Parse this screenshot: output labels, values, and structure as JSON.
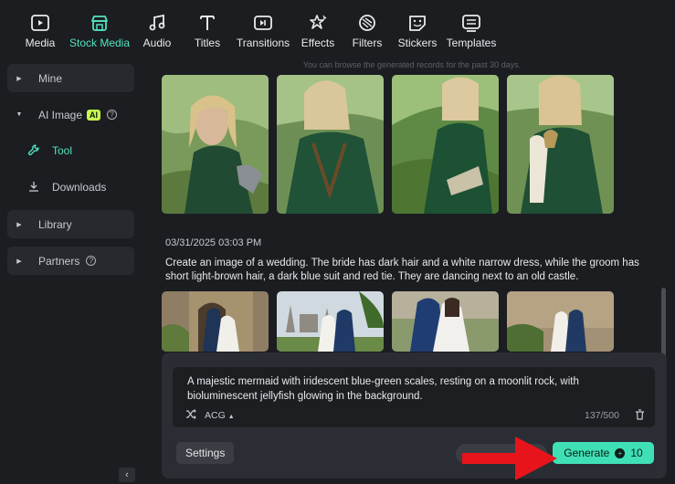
{
  "toolbar": {
    "tabs": [
      {
        "label": "Media",
        "icon": "media-icon"
      },
      {
        "label": "Stock Media",
        "icon": "stock-media-icon",
        "active": true
      },
      {
        "label": "Audio",
        "icon": "audio-note-icon"
      },
      {
        "label": "Titles",
        "icon": "titles-t-icon"
      },
      {
        "label": "Transitions",
        "icon": "transitions-icon"
      },
      {
        "label": "Effects",
        "icon": "effects-icon"
      },
      {
        "label": "Filters",
        "icon": "filters-icon"
      },
      {
        "label": "Stickers",
        "icon": "stickers-icon"
      },
      {
        "label": "Templates",
        "icon": "templates-icon"
      }
    ]
  },
  "sidebar": {
    "mine": "Mine",
    "ai_image": "AI Image",
    "ai_badge": "AI",
    "tool": "Tool",
    "downloads": "Downloads",
    "library": "Library",
    "partners": "Partners"
  },
  "main": {
    "notice": "You can browse the generated records for the past 30 days.",
    "record": {
      "timestamp": "03/31/2025 03:03 PM",
      "prompt": "Create an image of a wedding. The bride has dark hair and a white narrow dress, while the groom has short light-brown hair, a dark blue suit and red tie. They are dancing next to an old castle."
    }
  },
  "composer": {
    "text": "A majestic mermaid with iridescent blue-green scales, resting on a moonlit rock, with bioluminescent jellyfish glowing in the background.",
    "style": "ACG",
    "count": "137/500",
    "settings_label": "Settings",
    "generate_label": "Generate",
    "generate_cost": "10"
  },
  "colors": {
    "accent": "#3fe0b5",
    "active_text": "#52e3bf",
    "ai_badge": "#c7f94e",
    "annotation_arrow": "#e8141c"
  }
}
